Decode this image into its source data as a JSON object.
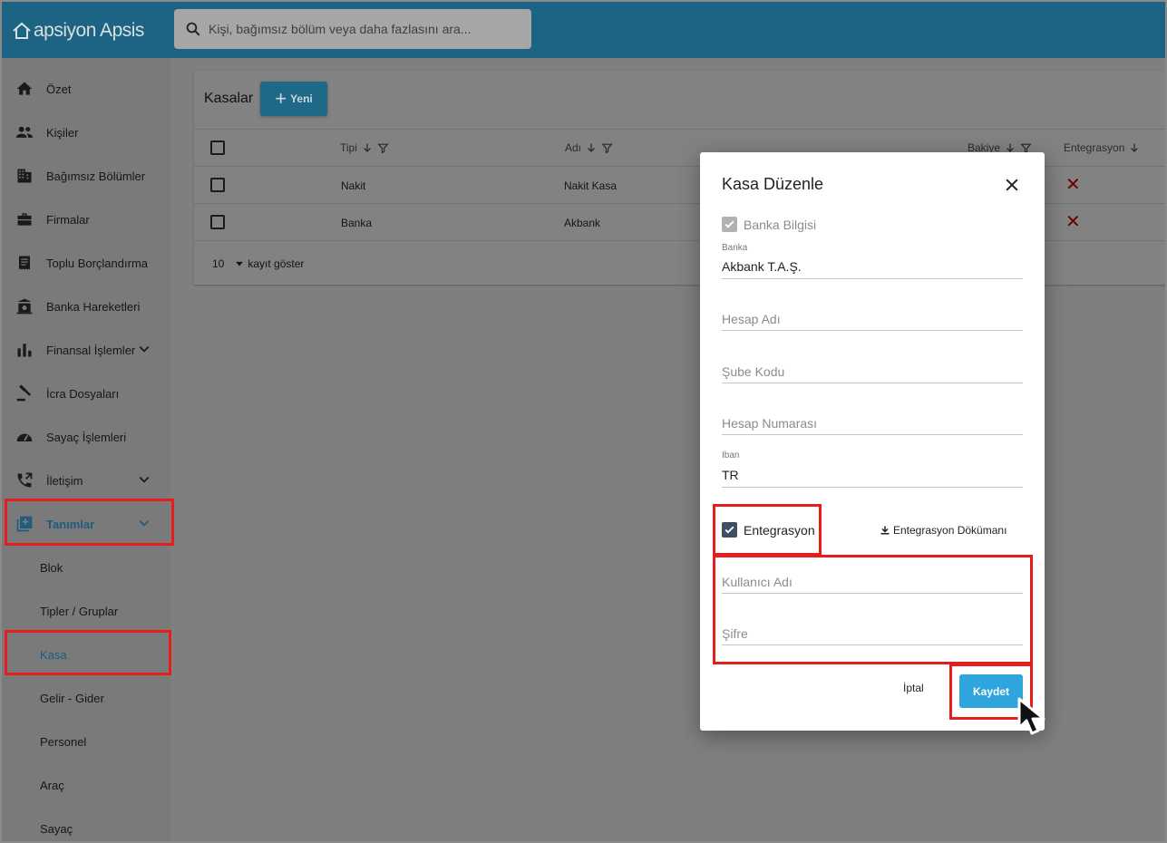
{
  "app": {
    "logo_text": "apsiyon Apsis"
  },
  "search": {
    "placeholder": "Kişi, bağımsız bölüm veya daha fazlasını ara..."
  },
  "sidebar": {
    "items": [
      {
        "label": "Özet",
        "icon": "home-icon"
      },
      {
        "label": "Kişiler",
        "icon": "people-icon"
      },
      {
        "label": "Bağımsız Bölümler",
        "icon": "building-icon"
      },
      {
        "label": "Firmalar",
        "icon": "briefcase-icon"
      },
      {
        "label": "Toplu Borçlandırma",
        "icon": "receipt-icon"
      },
      {
        "label": "Banka Hareketleri",
        "icon": "bank-icon"
      },
      {
        "label": "Finansal İşlemler",
        "icon": "bar-chart-icon",
        "expandable": true
      },
      {
        "label": "İcra Dosyaları",
        "icon": "gavel-icon"
      },
      {
        "label": "Sayaç İşlemleri",
        "icon": "gauge-icon"
      },
      {
        "label": "İletişim",
        "icon": "phone-forward-icon",
        "expandable": true
      },
      {
        "label": "Tanımlar",
        "icon": "library-add-icon",
        "expandable": true,
        "active": true
      }
    ],
    "subitems": [
      {
        "label": "Blok"
      },
      {
        "label": "Tipler / Gruplar"
      },
      {
        "label": "Kasa",
        "active": true
      },
      {
        "label": "Gelir - Gider"
      },
      {
        "label": "Personel"
      },
      {
        "label": "Araç"
      },
      {
        "label": "Sayaç"
      }
    ]
  },
  "kasalar": {
    "title": "Kasalar",
    "new_label": "Yeni",
    "columns": [
      "Tipi",
      "Adı",
      "Bakiye",
      "Entegrasyon"
    ],
    "rows": [
      {
        "tipi": "Nakit",
        "adi": "Nakit Kasa"
      },
      {
        "tipi": "Banka",
        "adi": "Akbank"
      }
    ],
    "page_size": "10",
    "page_size_label": "kayıt göster"
  },
  "dialog": {
    "title": "Kasa Düzenle",
    "banka_bilgisi_label": "Banka Bilgisi",
    "banka": {
      "label": "Banka",
      "value": "Akbank T.A.Ş."
    },
    "hesap_adi_placeholder": "Hesap Adı",
    "sube_kodu_placeholder": "Şube Kodu",
    "hesap_numarasi_placeholder": "Hesap Numarası",
    "iban": {
      "label": "Iban",
      "value": "TR"
    },
    "entegrasyon_label": "Entegrasyon",
    "entegrasyon_doc_label": "Entegrasyon Dökümanı",
    "kullanici_adi_placeholder": "Kullanıcı Adı",
    "sifre_placeholder": "Şifre",
    "cancel_label": "İptal",
    "save_label": "Kaydet"
  },
  "colors": {
    "header": "#1d6383",
    "accent": "#2fa5dd",
    "highlight": "#e51d1d",
    "error": "#6b0000"
  }
}
